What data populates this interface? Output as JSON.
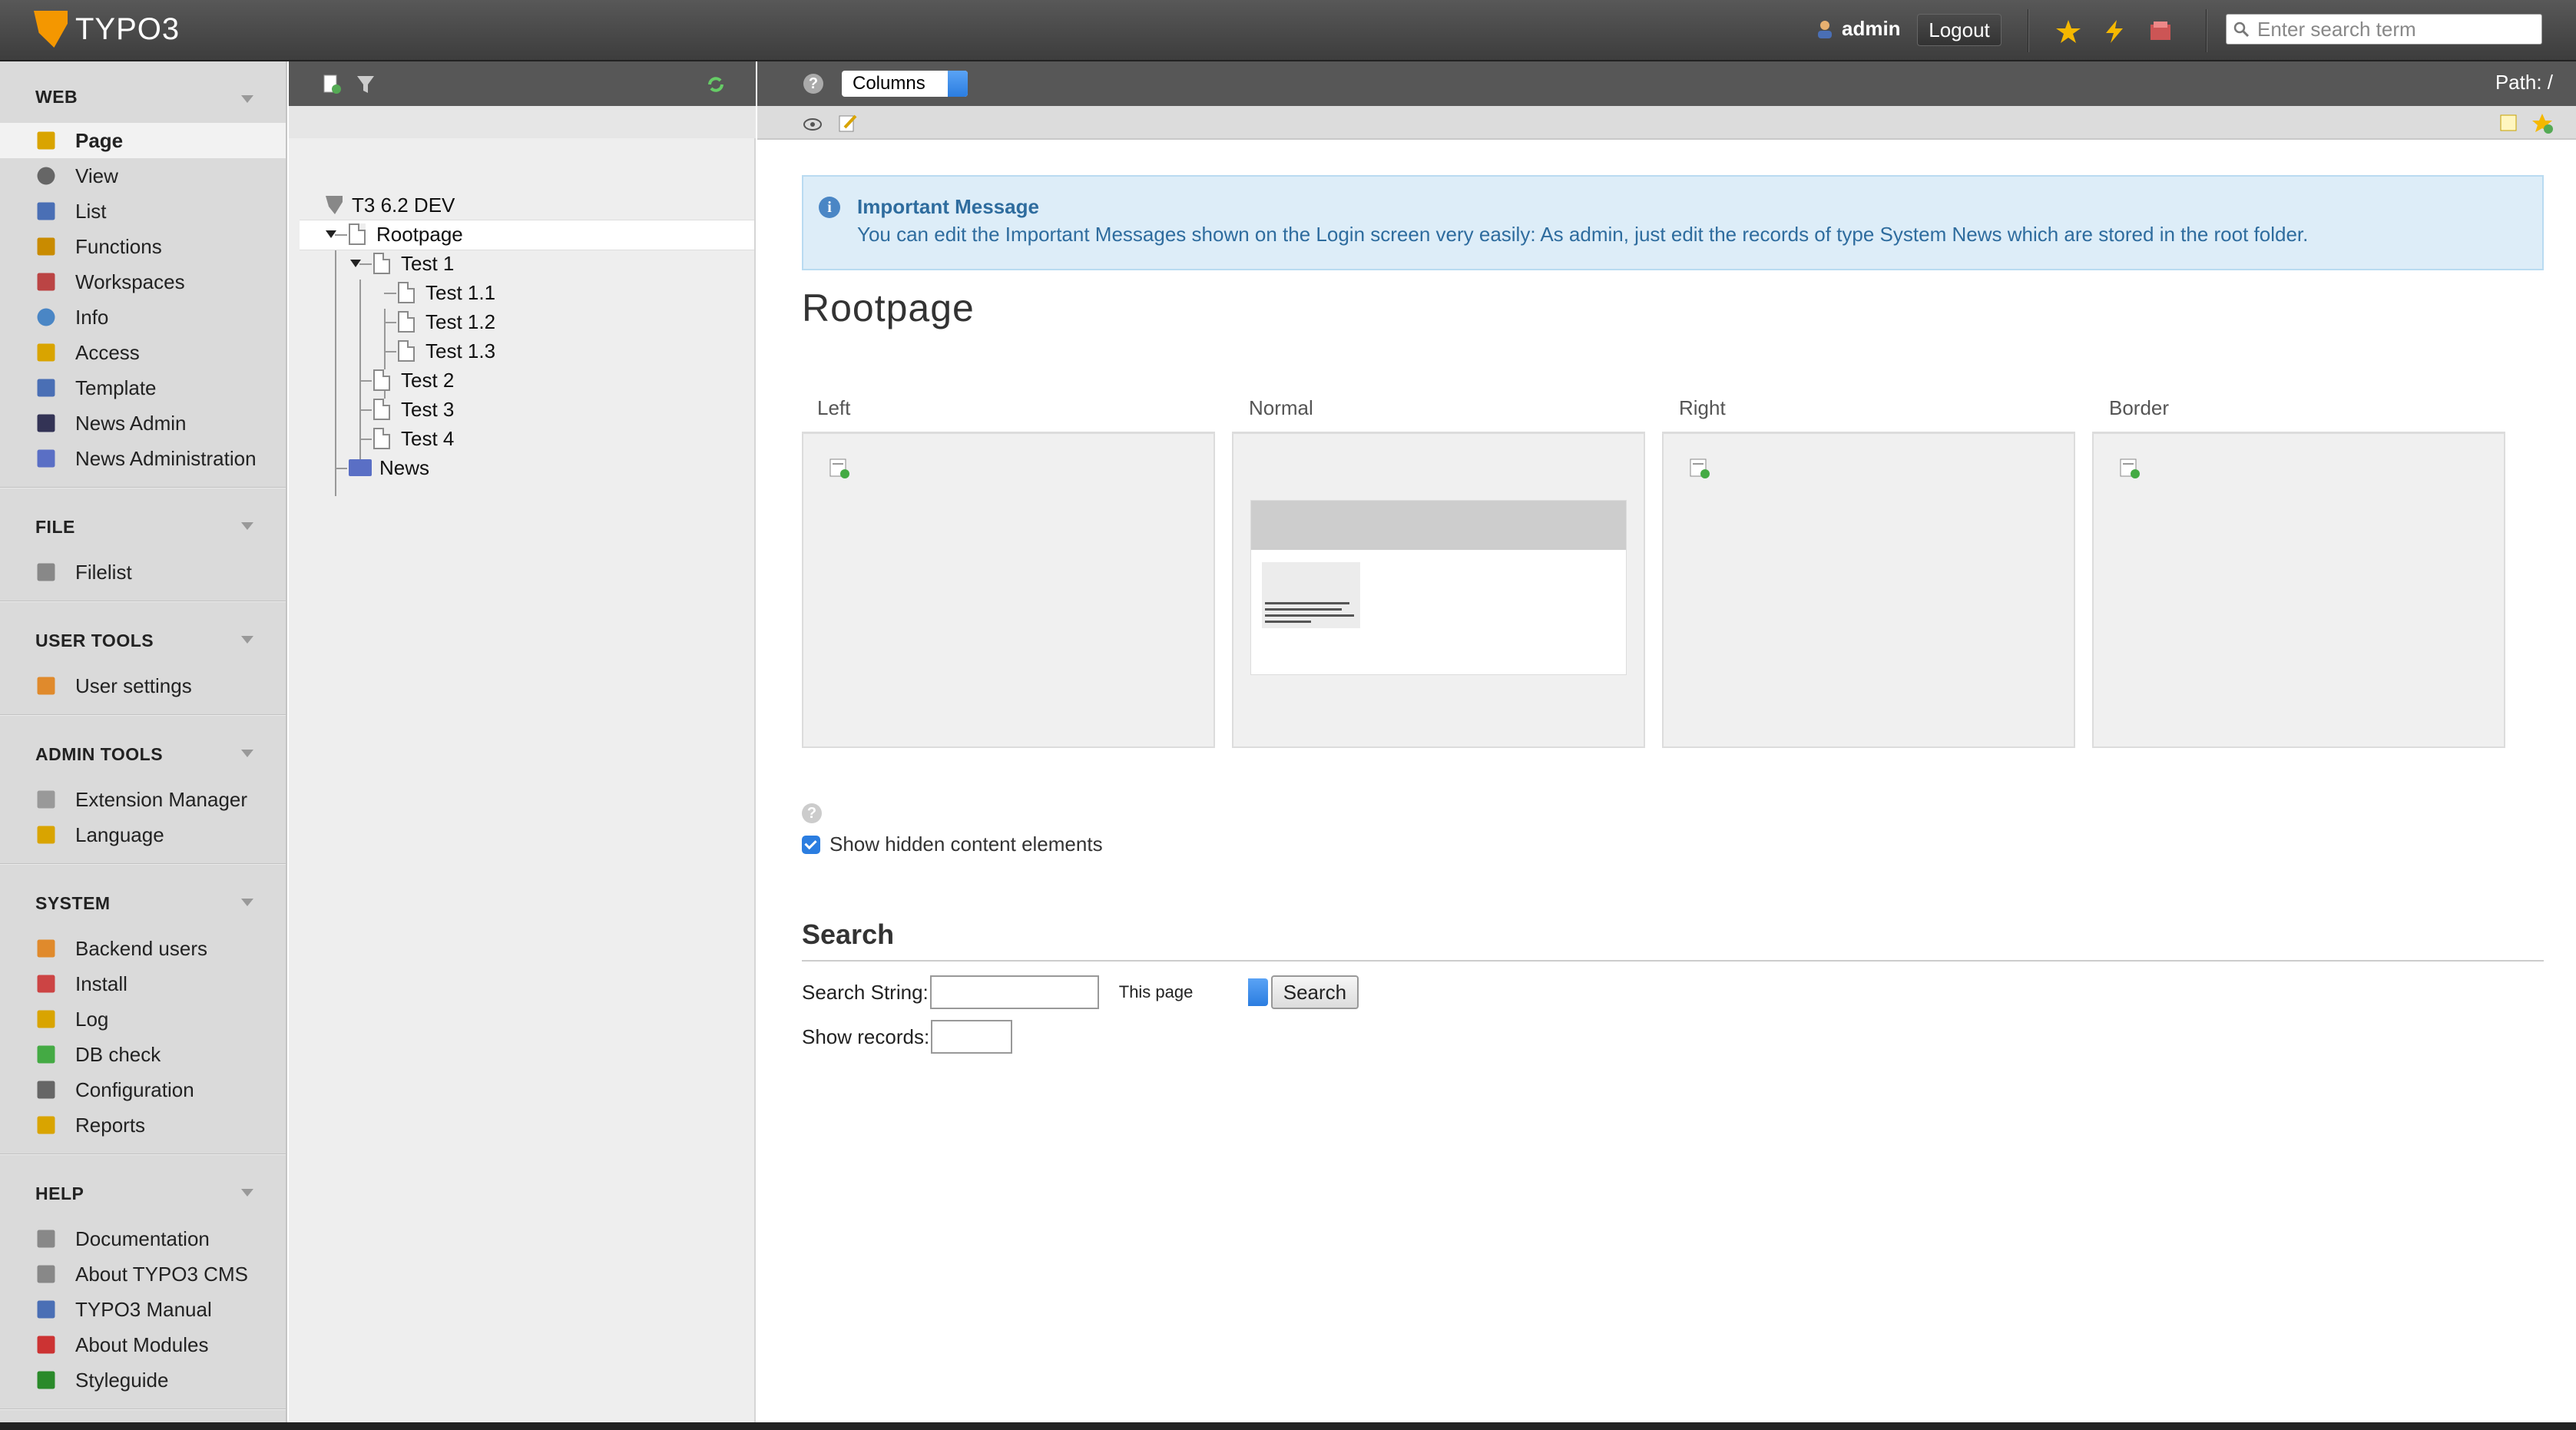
{
  "app": {
    "logo_text": "TYPO3"
  },
  "topbar": {
    "username": "admin",
    "logout_label": "Logout",
    "search_placeholder": "Enter search term",
    "icons": [
      "bookmark-star-icon",
      "flash-clear-cache-icon",
      "workspace-icon"
    ]
  },
  "modmenu": {
    "groups": [
      {
        "title": "WEB",
        "items": [
          {
            "label": "Page",
            "icon": "page-icon",
            "active": true
          },
          {
            "label": "View",
            "icon": "eye-icon"
          },
          {
            "label": "List",
            "icon": "list-icon"
          },
          {
            "label": "Functions",
            "icon": "wrench-icon"
          },
          {
            "label": "Workspaces",
            "icon": "workspaces-icon"
          },
          {
            "label": "Info",
            "icon": "info-icon"
          },
          {
            "label": "Access",
            "icon": "lock-icon"
          },
          {
            "label": "Template",
            "icon": "template-icon"
          },
          {
            "label": "News Admin",
            "icon": "news-admin-icon"
          },
          {
            "label": "News Administration",
            "icon": "folder-icon"
          }
        ]
      },
      {
        "title": "FILE",
        "items": [
          {
            "label": "Filelist",
            "icon": "filelist-icon"
          }
        ]
      },
      {
        "title": "USER TOOLS",
        "items": [
          {
            "label": "User settings",
            "icon": "user-settings-icon"
          }
        ]
      },
      {
        "title": "ADMIN TOOLS",
        "items": [
          {
            "label": "Extension Manager",
            "icon": "extension-icon"
          },
          {
            "label": "Language",
            "icon": "language-icon"
          }
        ]
      },
      {
        "title": "SYSTEM",
        "items": [
          {
            "label": "Backend users",
            "icon": "backend-users-icon"
          },
          {
            "label": "Install",
            "icon": "install-icon"
          },
          {
            "label": "Log",
            "icon": "log-icon"
          },
          {
            "label": "DB check",
            "icon": "db-check-icon"
          },
          {
            "label": "Configuration",
            "icon": "configuration-icon"
          },
          {
            "label": "Reports",
            "icon": "reports-icon"
          }
        ]
      },
      {
        "title": "HELP",
        "items": [
          {
            "label": "Documentation",
            "icon": "documentation-icon"
          },
          {
            "label": "About TYPO3 CMS",
            "icon": "about-icon"
          },
          {
            "label": "TYPO3 Manual",
            "icon": "manual-icon"
          },
          {
            "label": "About Modules",
            "icon": "about-modules-icon"
          },
          {
            "label": "Styleguide",
            "icon": "styleguide-icon"
          }
        ]
      }
    ]
  },
  "tree": {
    "root": "T3 6.2 DEV",
    "nodes": [
      "Rootpage",
      "Test 1",
      "Test 1.1",
      "Test 1.2",
      "Test 1.3",
      "Test 2",
      "Test 3",
      "Test 4",
      "News"
    ]
  },
  "docheader": {
    "view_mode": "Columns",
    "path_label": "Path: /"
  },
  "message": {
    "title": "Important Message",
    "body": "You can edit the Important Messages shown on the Login screen very easily: As admin, just edit the records of type System News which are stored in the root folder."
  },
  "page": {
    "title": "Rootpage",
    "columns": [
      "Left",
      "Normal",
      "Right",
      "Border"
    ],
    "show_hidden_label": "Show hidden content elements"
  },
  "search": {
    "heading": "Search",
    "string_label": "Search String:",
    "scope_value": "This page",
    "button_label": "Search",
    "records_label": "Show records:"
  },
  "colors": {
    "accent": "#f49700",
    "topbar": "#3d3d3d",
    "info_bg": "#ddedf8",
    "info_text": "#2e6c9e"
  }
}
